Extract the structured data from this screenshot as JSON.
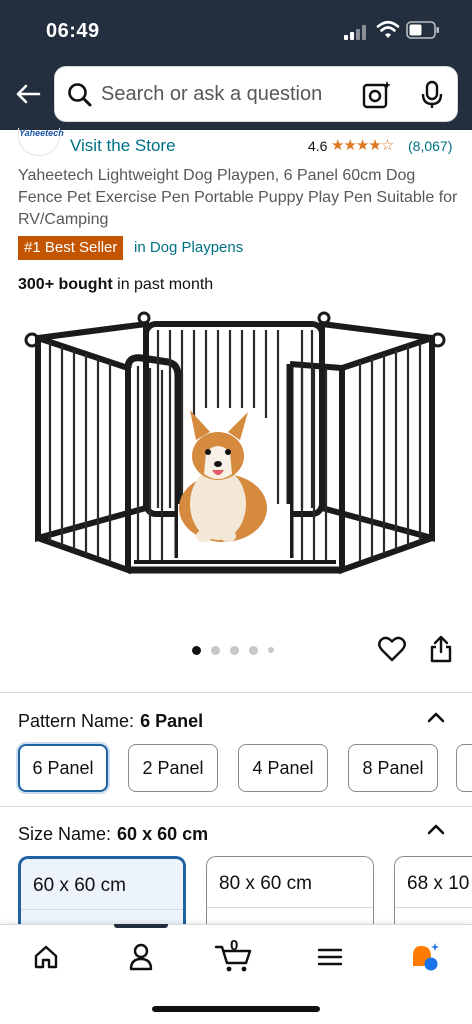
{
  "status_bar": {
    "time": "06:49"
  },
  "search": {
    "placeholder": "Search or ask a question"
  },
  "store": {
    "logo_text": "Yaheetech",
    "link_label": "Visit the Store",
    "rating": "4.6",
    "stars": "★★★★☆",
    "review_count": "(8,067)"
  },
  "product": {
    "title": "Yaheetech Lightweight Dog Playpen, 6 Panel 60cm Dog Fence Pet Exercise Pen Portable Puppy Play Pen Suitable for RV/Camping",
    "badge": "#1 Best Seller",
    "badge_category": "in Dog Playpens",
    "bought_bold": "300+ bought",
    "bought_rest": " in past month",
    "image_count": 5,
    "active_image": 1
  },
  "pattern": {
    "label": "Pattern Name:",
    "selected": "6 Panel",
    "options": [
      "6 Panel",
      "2 Panel",
      "4 Panel",
      "8 Panel"
    ]
  },
  "size": {
    "label": "Size Name:",
    "selected": "60 x 60 cm",
    "options": [
      "60 x 60 cm",
      "80 x 60 cm",
      "68 x 10"
    ]
  },
  "cart": {
    "count": "0"
  },
  "colors": {
    "header_bg": "#232f3e",
    "link": "#007185",
    "badge": "#c45500",
    "stars": "#de7921",
    "selected_border": "#2162a1"
  },
  "icons": [
    "back-arrow-icon",
    "search-icon",
    "camera-lens-icon",
    "microphone-icon",
    "heart-icon",
    "share-icon",
    "chevron-up-icon",
    "home-icon",
    "account-icon",
    "cart-icon",
    "menu-icon",
    "rufus-ai-icon"
  ]
}
